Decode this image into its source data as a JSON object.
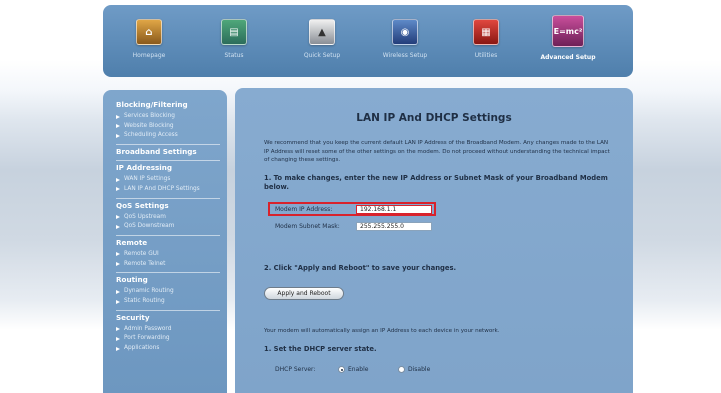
{
  "nav": {
    "items": [
      {
        "label": "Homepage",
        "icon": "house-icon"
      },
      {
        "label": "Status",
        "icon": "status-icon"
      },
      {
        "label": "Quick Setup",
        "icon": "quick-setup-icon"
      },
      {
        "label": "Wireless Setup",
        "icon": "wireless-icon"
      },
      {
        "label": "Utilities",
        "icon": "toolbox-icon"
      },
      {
        "label": "Advanced Setup",
        "icon": "advanced-icon",
        "icon_text": "E=mc²",
        "active": true
      }
    ]
  },
  "sidebar": {
    "sections": [
      {
        "heading": "Blocking/Filtering",
        "items": [
          "Services Blocking",
          "Website Blocking",
          "Scheduling Access"
        ]
      },
      {
        "heading": "Broadband Settings",
        "items": []
      },
      {
        "heading": "IP Addressing",
        "items": [
          "WAN IP Settings",
          "LAN IP And DHCP Settings"
        ]
      },
      {
        "heading": "QoS Settings",
        "items": [
          "QoS Upstream",
          "QoS Downstream"
        ]
      },
      {
        "heading": "Remote",
        "items": [
          "Remote GUI",
          "Remote Telnet"
        ]
      },
      {
        "heading": "Routing",
        "items": [
          "Dynamic Routing",
          "Static Routing"
        ]
      },
      {
        "heading": "Security",
        "items": [
          "Admin Password",
          "Port Forwarding",
          "Applications"
        ]
      }
    ]
  },
  "main": {
    "title": "LAN IP And DHCP Settings",
    "intro": "We recommend that you keep the current default LAN IP Address of the Broadband Modem. Any changes made to the LAN IP Address will reset some of the other settings on the modem. Do not proceed without understanding the technical impact of changing these settings.",
    "step1": "1. To make changes, enter the new IP Address or Subnet Mask of your Broadband Modem below.",
    "ip_label": "Modem IP Address:",
    "ip_value": "192.168.1.1",
    "mask_label": "Modem Subnet Mask:",
    "mask_value": "255.255.255.0",
    "step2": "2. Click \"Apply and Reboot\" to save your changes.",
    "apply_button": "Apply and Reboot",
    "assign_text": "Your modem will automatically assign an IP Address to each device in your network.",
    "dhcp_step": "1. Set the DHCP server state.",
    "dhcp_label": "DHCP Server:",
    "dhcp_enable": "Enable",
    "dhcp_disable": "Disable",
    "dhcp_selected": "Enable"
  },
  "colors": {
    "nav_bg": "#5a88b8",
    "sidebar_bg": "#7aa1c8",
    "content_bg": "#84a8ce",
    "highlight": "#d8222c"
  }
}
